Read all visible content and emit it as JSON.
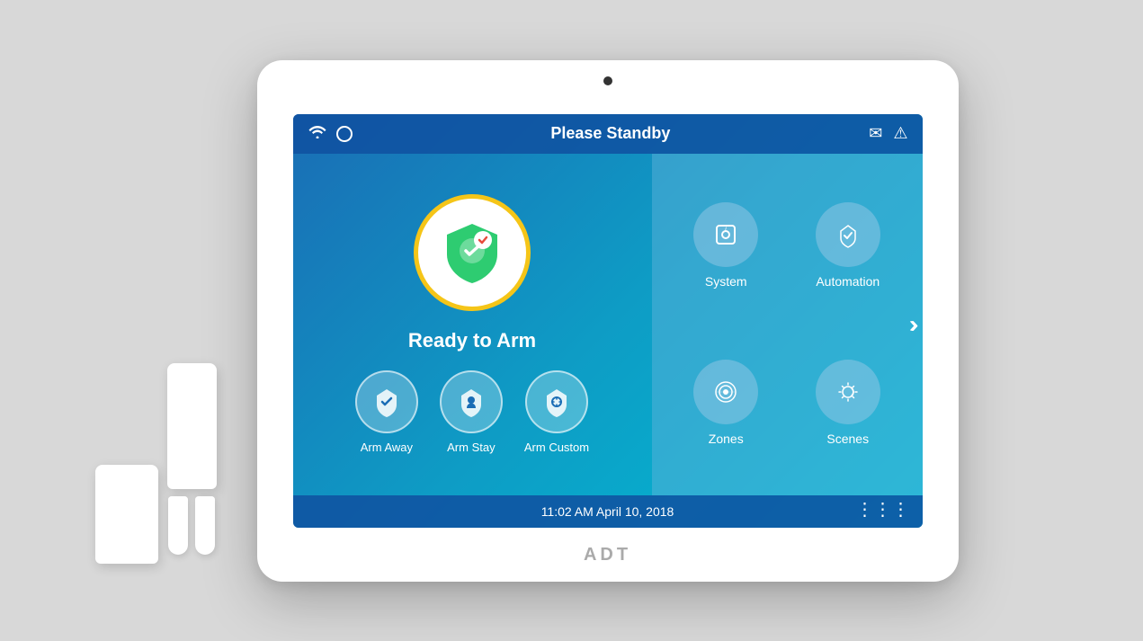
{
  "status_bar": {
    "title": "Please Standby",
    "wifi_icon": "wifi",
    "circle_icon": "○",
    "mail_icon": "✉",
    "alert_icon": "⚠"
  },
  "main": {
    "ready_label": "Ready to Arm",
    "arm_buttons": [
      {
        "id": "arm-away",
        "label": "Arm Away"
      },
      {
        "id": "arm-stay",
        "label": "Arm Stay"
      },
      {
        "id": "arm-custom",
        "label": "Arm Custom"
      }
    ],
    "menu_items": [
      {
        "id": "system",
        "label": "System"
      },
      {
        "id": "automation",
        "label": "Automation"
      },
      {
        "id": "zones",
        "label": "Zones"
      },
      {
        "id": "scenes",
        "label": "Scenes"
      }
    ],
    "next_arrow": "›"
  },
  "bottom_bar": {
    "datetime": "11:02 AM April 10, 2018"
  },
  "brand": {
    "logo": "ADT"
  },
  "colors": {
    "screen_bg": "#1a6db5",
    "status_bar": "rgba(15,80,160,0.85)",
    "badge_border": "#f5c518",
    "shield_green": "#2ecc71",
    "arm_circle_bg": "rgba(255,255,255,0.25)",
    "menu_circle_bg": "rgba(150,200,230,0.5)"
  }
}
